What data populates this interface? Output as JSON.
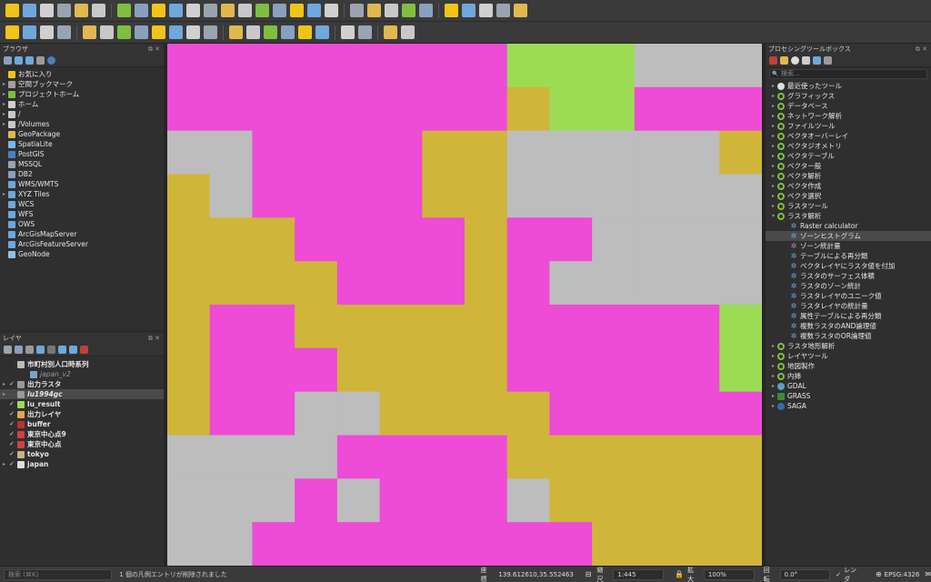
{
  "colors": {
    "magenta": "#ee4bd6",
    "olive": "#cfb53a",
    "gray": "#bdbdbd",
    "green": "#9bdc54"
  },
  "toolbar1": [
    "open-folder-icon",
    "save-icon",
    "save-as-icon",
    "print-layout-icon",
    "layout-manager-icon",
    "style-manager-icon",
    "pan-icon",
    "pan-to-selection-icon",
    "zoom-in-icon",
    "zoom-out-icon",
    "zoom-full-icon",
    "zoom-to-selection-icon",
    "zoom-to-layer-icon",
    "zoom-native-icon",
    "zoom-last-icon",
    "zoom-next-icon",
    "new-bookmark-icon",
    "show-bookmarks-icon",
    "refresh-icon",
    "identify-icon",
    "select-icon",
    "deselect-icon",
    "attribute-table-icon",
    "statistics-icon",
    "gear-icon",
    "sum-icon",
    "measure-icon",
    "annotation-icon",
    "text-annotation-icon"
  ],
  "toolbar2": [
    "data-source-manager-icon",
    "new-layer-icon",
    "digitize-icon",
    "edit-icon",
    "save-edits-icon",
    "add-point-icon",
    "vertex-tool-icon",
    "cut-icon",
    "copy-icon",
    "paste-icon",
    "undo-icon",
    "redo-icon",
    "label-icon",
    "label-pin-icon",
    "label-show-icon",
    "label-move-icon",
    "label-rotate-icon",
    "label-change-icon",
    "plugin-icon",
    "python-icon",
    "help-icon",
    "apple-icon"
  ],
  "browser": {
    "title": "ブラウザ",
    "items": [
      {
        "label": "お気に入り",
        "icon": "star-icon",
        "color": "#f0c419",
        "arrow": ""
      },
      {
        "label": "空間ブックマーク",
        "icon": "bookmark-icon",
        "color": "#a0a0a0",
        "arrow": "▸"
      },
      {
        "label": "プロジェクトホーム",
        "icon": "project-home-icon",
        "color": "#7fbf3f",
        "arrow": "▸"
      },
      {
        "label": "ホーム",
        "icon": "home-icon",
        "color": "#d0d0d0",
        "arrow": "▸"
      },
      {
        "label": "/",
        "icon": "folder-icon",
        "color": "#c8c8c8",
        "arrow": "▸"
      },
      {
        "label": "/Volumes",
        "icon": "folder-icon",
        "color": "#c8c8c8",
        "arrow": "▸"
      },
      {
        "label": "GeoPackage",
        "icon": "geopackage-icon",
        "color": "#e0b84f",
        "arrow": ""
      },
      {
        "label": "SpatiaLite",
        "icon": "spatialite-icon",
        "color": "#7ab6e8",
        "arrow": ""
      },
      {
        "label": "PostGIS",
        "icon": "postgis-icon",
        "color": "#4f7fbf",
        "arrow": ""
      },
      {
        "label": "MSSQL",
        "icon": "mssql-icon",
        "color": "#9aa4b0",
        "arrow": ""
      },
      {
        "label": "DB2",
        "icon": "db2-icon",
        "color": "#8aa0bf",
        "arrow": ""
      },
      {
        "label": "WMS/WMTS",
        "icon": "wms-icon",
        "color": "#6fa8dc",
        "arrow": ""
      },
      {
        "label": "XYZ Tiles",
        "icon": "xyz-tiles-icon",
        "color": "#6fa8dc",
        "arrow": "▸"
      },
      {
        "label": "WCS",
        "icon": "wcs-icon",
        "color": "#6fa8dc",
        "arrow": ""
      },
      {
        "label": "WFS",
        "icon": "wfs-icon",
        "color": "#6fa8dc",
        "arrow": ""
      },
      {
        "label": "OWS",
        "icon": "ows-icon",
        "color": "#6fa8dc",
        "arrow": ""
      },
      {
        "label": "ArcGisMapServer",
        "icon": "arcgis-map-icon",
        "color": "#6fa8dc",
        "arrow": ""
      },
      {
        "label": "ArcGisFeatureServer",
        "icon": "arcgis-feature-icon",
        "color": "#6fa8dc",
        "arrow": ""
      },
      {
        "label": "GeoNode",
        "icon": "geonode-icon",
        "color": "#8fc0e8",
        "arrow": ""
      }
    ]
  },
  "layers": {
    "title": "レイヤ",
    "items": [
      {
        "label": "市町村別人口時系列",
        "check": "",
        "icon_color": "#bbbbbb",
        "arrow": "",
        "italic": false,
        "bold": true,
        "indent": 0
      },
      {
        "label": "japan_v2",
        "check": "",
        "icon_color": "#7aa3c9",
        "arrow": "",
        "italic": true,
        "bold": false,
        "indent": 1
      },
      {
        "label": "出力ラスタ",
        "check": "✓",
        "icon_color": "#9a9a9a",
        "arrow": "▸",
        "italic": false,
        "bold": true,
        "indent": 0
      },
      {
        "label": "lu1994gc",
        "check": "",
        "icon_color": "#9a9a9a",
        "arrow": "▸",
        "italic": true,
        "bold": true,
        "indent": 0
      },
      {
        "label": "lu_result",
        "check": "✓",
        "icon_color": "#9bdc54",
        "arrow": "",
        "italic": false,
        "bold": true,
        "indent": 0
      },
      {
        "label": "出力レイヤ",
        "check": "✓",
        "icon_color": "#e0a84f",
        "arrow": "",
        "italic": false,
        "bold": true,
        "indent": 0
      },
      {
        "label": "buffer",
        "check": "✓",
        "icon_color": "#c03030",
        "arrow": "",
        "italic": false,
        "bold": true,
        "indent": 0
      },
      {
        "label": "東京中心点9",
        "check": "✓",
        "icon_color": "#d04040",
        "arrow": "",
        "italic": false,
        "bold": true,
        "indent": 0
      },
      {
        "label": "東京中心点",
        "check": "✓",
        "icon_color": "#d04040",
        "arrow": "",
        "italic": false,
        "bold": true,
        "indent": 0
      },
      {
        "label": "tokyo",
        "check": "✓",
        "icon_color": "#c8b08a",
        "arrow": "",
        "italic": false,
        "bold": true,
        "indent": 0
      },
      {
        "label": "japan",
        "check": "✓",
        "icon_color": "#dddddd",
        "arrow": "▸",
        "italic": false,
        "bold": true,
        "indent": 0
      }
    ]
  },
  "processing": {
    "title": "プロセシングツールボックス",
    "search_placeholder": "検索...",
    "items": [
      {
        "label": "最近使ったツール",
        "kind": "clock",
        "arrow": "▸",
        "indent": 0
      },
      {
        "label": "グラフィックス",
        "kind": "q",
        "arrow": "▸",
        "indent": 0
      },
      {
        "label": "データベース",
        "kind": "q",
        "arrow": "▸",
        "indent": 0
      },
      {
        "label": "ネットワーク解析",
        "kind": "q",
        "arrow": "▸",
        "indent": 0
      },
      {
        "label": "ファイルツール",
        "kind": "q",
        "arrow": "▸",
        "indent": 0
      },
      {
        "label": "ベクタオーバーレイ",
        "kind": "q",
        "arrow": "▸",
        "indent": 0
      },
      {
        "label": "ベクタジオメトリ",
        "kind": "q",
        "arrow": "▸",
        "indent": 0
      },
      {
        "label": "ベクタテーブル",
        "kind": "q",
        "arrow": "▸",
        "indent": 0
      },
      {
        "label": "ベクター般",
        "kind": "q",
        "arrow": "▸",
        "indent": 0
      },
      {
        "label": "ベクタ解析",
        "kind": "q",
        "arrow": "▸",
        "indent": 0
      },
      {
        "label": "ベクタ作成",
        "kind": "q",
        "arrow": "▸",
        "indent": 0
      },
      {
        "label": "ベクタ選択",
        "kind": "q",
        "arrow": "▸",
        "indent": 0
      },
      {
        "label": "ラスタツール",
        "kind": "q",
        "arrow": "▸",
        "indent": 0
      },
      {
        "label": "ラスタ解析",
        "kind": "q",
        "arrow": "▾",
        "indent": 0
      },
      {
        "label": "Raster calculator",
        "kind": "gear",
        "arrow": "",
        "indent": 1
      },
      {
        "label": "ゾーンヒストグラム",
        "kind": "gear",
        "arrow": "",
        "indent": 1,
        "selected": true
      },
      {
        "label": "ゾーン統計量",
        "kind": "gear2",
        "arrow": "",
        "indent": 1
      },
      {
        "label": "テーブルによる再分類",
        "kind": "gear",
        "arrow": "",
        "indent": 1
      },
      {
        "label": "ベクタレイヤにラスタ値を付加",
        "kind": "gear",
        "arrow": "",
        "indent": 1
      },
      {
        "label": "ラスタのサーフェス体積",
        "kind": "gear",
        "arrow": "",
        "indent": 1
      },
      {
        "label": "ラスタのゾーン統計",
        "kind": "gear",
        "arrow": "",
        "indent": 1
      },
      {
        "label": "ラスタレイヤのユニーク値",
        "kind": "gear",
        "arrow": "",
        "indent": 1
      },
      {
        "label": "ラスタレイヤの統計量",
        "kind": "gear",
        "arrow": "",
        "indent": 1
      },
      {
        "label": "属性テーブルによる再分類",
        "kind": "gear",
        "arrow": "",
        "indent": 1
      },
      {
        "label": "複数ラスタのAND論理値",
        "kind": "gear",
        "arrow": "",
        "indent": 1
      },
      {
        "label": "複数ラスタのOR論理値",
        "kind": "gear",
        "arrow": "",
        "indent": 1
      },
      {
        "label": "ラスタ地形解析",
        "kind": "q",
        "arrow": "▸",
        "indent": 0
      },
      {
        "label": "レイヤツール",
        "kind": "q",
        "arrow": "▸",
        "indent": 0
      },
      {
        "label": "地図製作",
        "kind": "q",
        "arrow": "▸",
        "indent": 0
      },
      {
        "label": "内挿",
        "kind": "q",
        "arrow": "▸",
        "indent": 0
      },
      {
        "label": "GDAL",
        "kind": "gdal",
        "arrow": "▸",
        "indent": 0
      },
      {
        "label": "GRASS",
        "kind": "grass",
        "arrow": "▸",
        "indent": 0
      },
      {
        "label": "SAGA",
        "kind": "saga",
        "arrow": "▸",
        "indent": 0
      }
    ]
  },
  "status": {
    "search_placeholder": "検索 (⌘K)",
    "message": "1 個の凡例エントリが削除されました",
    "coord_label": "座標",
    "coord_value": "139.612610,35.552463",
    "scale_label": "縮尺",
    "scale_value": "1:445",
    "magnifier_label": "拡大",
    "magnifier_value": "100%",
    "rotation_label": "回転",
    "rotation_value": "0.0°",
    "render_label": "レンダ",
    "crs": "EPSG:4326"
  },
  "map_grid": {
    "cols": 14,
    "rows": 12,
    "cells": [
      "MMMMMMMMGGGBBB",
      "MMMMMMMMOGGMMM",
      "BBMMMMOOBBBBBO",
      "OBMMMMOOBBBBBB",
      "OOOMMMMOMMBBBB",
      "OOOOMMMOMBBBBB",
      "OMMOOOOOMMMMMG",
      "OMMMOOOOMMMMMG",
      "OMMBBOOOOMMMMM",
      "BBBBMMMMOOOOOO",
      "BBBMBMMMBOOOOO",
      "BBMMMMMMMMOOOO"
    ]
  }
}
